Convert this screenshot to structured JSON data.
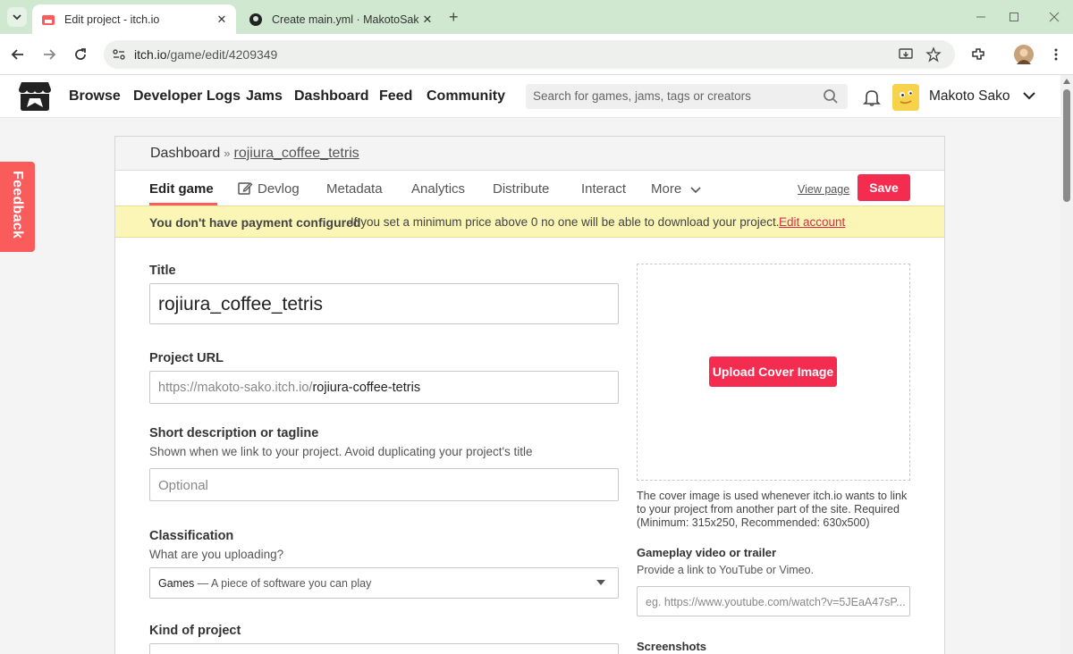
{
  "browser": {
    "tabs": [
      {
        "title": "Edit project - itch.io",
        "active": true,
        "close": "✕"
      },
      {
        "title": "Create main.yml · MakotoSako/",
        "active": false,
        "close": "✕"
      }
    ],
    "new_tab": "+",
    "url_host": "itch.io",
    "url_path": "/game/edit/4209349"
  },
  "site": {
    "nav": [
      "Browse",
      "Developer Logs",
      "Jams",
      "Dashboard",
      "Feed",
      "Community"
    ],
    "search_placeholder": "Search for games, jams, tags or creators",
    "username": "Makoto Sako"
  },
  "feedback_label": "Feedback",
  "breadcrumb": {
    "root": "Dashboard",
    "sep": "»",
    "project": "rojiura_coffee_tetris"
  },
  "edit_tabs": [
    "Edit game",
    "Devlog",
    "Metadata",
    "Analytics",
    "Distribute",
    "Interact",
    "More"
  ],
  "view_page": "View page",
  "save_label": "Save",
  "warning": {
    "title": "You don't have payment configured",
    "text": "If you set a minimum price above 0 no one will be able to download your project.",
    "link": "Edit account"
  },
  "form": {
    "title_label": "Title",
    "title_value": "rojiura_coffee_tetris",
    "url_label": "Project URL",
    "url_prefix": "https://makoto-sako.itch.io/",
    "url_slug": "rojiura-coffee-tetris",
    "tagline_label": "Short description or tagline",
    "tagline_help": "Shown when we link to your project. Avoid duplicating your project's title",
    "tagline_placeholder": "Optional",
    "class_label": "Classification",
    "class_help": "What are you uploading?",
    "class_value_main": "Games",
    "class_value_desc": " — A piece of software you can play",
    "kind_label": "Kind of project"
  },
  "cover": {
    "button": "Upload Cover Image",
    "note": "The cover image is used whenever itch.io wants to link to your project from another part of the site. Required (Minimum: 315x250, Recommended: 630x500)"
  },
  "video": {
    "label": "Gameplay video or trailer",
    "help": "Provide a link to YouTube or Vimeo.",
    "placeholder": "eg. https://www.youtube.com/watch?v=5JEaA47sP..."
  },
  "screenshots_label": "Screenshots",
  "colors": {
    "accent": "#fa5c5c",
    "button": "#f42c4f",
    "warning_bg": "#fbf6b6",
    "tab_strip": "#cfe8cf"
  }
}
